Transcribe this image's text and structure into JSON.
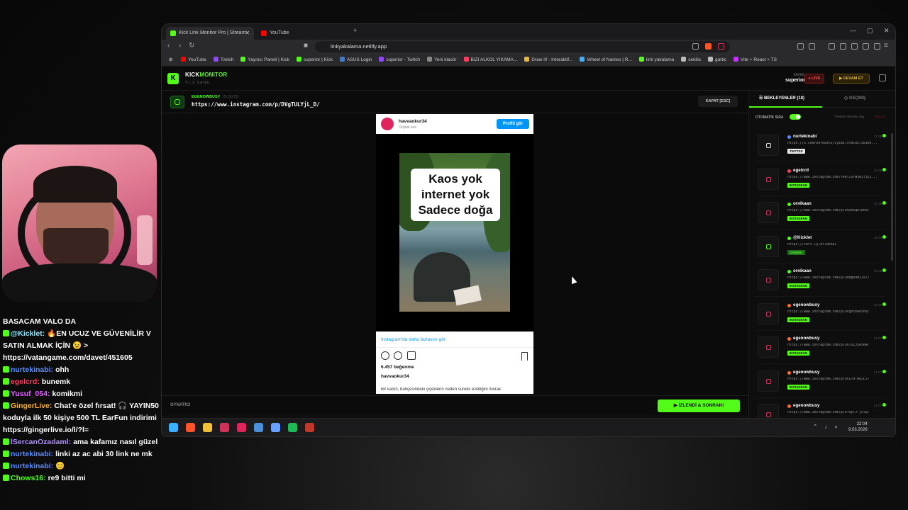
{
  "chat": [
    {
      "user": "",
      "user_color": "#ffffff",
      "text": "BASACAM VALO DA"
    },
    {
      "user": "@Kicklet:",
      "user_color": "#8be9fd",
      "text": "🔥EN UCUZ VE GÜVENİLİR V SATIN ALMAK İÇİN 😉 > https://vatangame.com/davet/451605"
    },
    {
      "user": "nurtekinabi:",
      "user_color": "#5b8cff",
      "text": "ohh"
    },
    {
      "user": "egelcrd:",
      "user_color": "#ff3b5c",
      "text": "bunemk"
    },
    {
      "user": "Yusuf_054:",
      "user_color": "#e060ff",
      "text": "komikmi"
    },
    {
      "user": "GingerLive:",
      "user_color": "#ffb020",
      "text": "Chat'e özel fırsat! 🎧 YAYIN50 koduyla ilk 50 kişiye 500 TL EarFun indirimi https://gingerlive.io/l/?l="
    },
    {
      "user": "lSercanOzadaml:",
      "user_color": "#b08cff",
      "text": "ama kafamız nasıl güzel"
    },
    {
      "user": "nurtekinabi:",
      "user_color": "#5b8cff",
      "text": "linki az ac abi 30 link ne mk"
    },
    {
      "user": "nurtekinabi:",
      "user_color": "#5b8cff",
      "text": "😊"
    },
    {
      "user": "Chows16:",
      "user_color": "#53fc18",
      "text": "re9 bitti mi"
    }
  ],
  "browser": {
    "tabs": [
      {
        "label": "Kick Link Monitor Pro | Stream",
        "active": true,
        "color": "#53fc18"
      },
      {
        "label": "YouTube",
        "active": false,
        "color": "#ff0000"
      }
    ],
    "url": "linkyakalama.netlify.app",
    "bookmarks": [
      {
        "label": "YouTube",
        "color": "#ff0000"
      },
      {
        "label": "Twitch",
        "color": "#9146ff"
      },
      {
        "label": "Yayıncı Paneli | Kick",
        "color": "#53fc18"
      },
      {
        "label": "superior | Kick",
        "color": "#53fc18"
      },
      {
        "label": "ASUS Login",
        "color": "#3a7bd5"
      },
      {
        "label": "superior - Twitch",
        "color": "#9146ff"
      },
      {
        "label": "Yeni klasör",
        "color": "#888888"
      },
      {
        "label": "BIZI ALKOL YIKAMA...",
        "color": "#ff3b5c"
      },
      {
        "label": "Draw it! - Interaktif...",
        "color": "#e8b830"
      },
      {
        "label": "Wheel of Names | R...",
        "color": "#3ab0ff"
      },
      {
        "label": "link yakalama",
        "color": "#53fc18"
      },
      {
        "label": "cekilis",
        "color": "#bbbbbb"
      },
      {
        "label": "gartic",
        "color": "#bbbbbb"
      },
      {
        "label": "Vite + React + TS",
        "color": "#bd34fe"
      }
    ]
  },
  "app": {
    "logo_letter": "K",
    "brand_a": "KICK",
    "brand_b": "MONITOR",
    "version": "V1.0 SAGE",
    "kanal_label": "KANAL",
    "kanal_name": "superior",
    "live_label": "● LIVE",
    "devam_label": "▶ DEVAM ET",
    "current": {
      "user": "EGENOWBUSY",
      "time": "21:50:23",
      "url": "https://www.instagram.com/p/DVgTULYjL_D/"
    },
    "close_label": "KAPAT [ESC]",
    "player_label": "OYNATICI",
    "next_label": "▶ İZLENDİ & SONRAKI"
  },
  "embed": {
    "user": "havvaokur34",
    "sub": "Orijinal ses",
    "profile_btn": "Profili gör",
    "overlay_lines": [
      "Kaos yok",
      "internet yok",
      "Sadece doğa"
    ],
    "more": "Instagram'da daha fazlasını gör",
    "likes": "6.457 beğenme",
    "user2": "havvaokur34",
    "caption": "Bir kadın, bahçesindeki çiçeklerin neden sürekli ezildiğini merak"
  },
  "side": {
    "tab_waiting": "BEKLEYENLER (18)",
    "tab_history": "GEÇMİŞ",
    "auto_label": "OTOMATİK SIRA",
    "auto_on": true,
    "mark_all": "Tümünü Okundu Say",
    "clear": "Temizle",
    "items": [
      {
        "user": "nurtekinabi",
        "dot": "#5b8cff",
        "time": "21:38",
        "url": "https://x.com/berbathiriyimi/status/20309...",
        "tag": "TWITTER",
        "tag_bg": "#e8e8e8",
        "tag_fg": "#111111",
        "icon": "x"
      },
      {
        "user": "egelcrd",
        "dot": "#ff3b5c",
        "time": "21:06",
        "url": "https://www.instagram.com/reel/DTWyN1fjE1...",
        "tag": "INSTAGRAM",
        "tag_bg": "#53fc18",
        "tag_fg": "#0a0a0a",
        "icon": "ig"
      },
      {
        "user": "ornikaan",
        "dot": "#53fc18",
        "time": "21:38",
        "url": "https://www.instagram.com/p/DSQ45qkiAnb/",
        "tag": "INSTAGRAM",
        "tag_bg": "#53fc18",
        "tag_fg": "#0a0a0a",
        "icon": "ig"
      },
      {
        "user": "@Kicklet",
        "dot": "#53fc18",
        "time": "21:34",
        "url": "https://cutt.ly/8tTwnnq1",
        "tag": "GENERIC",
        "tag_bg": "#1d6a20",
        "tag_fg": "#53fc18",
        "icon": "link"
      },
      {
        "user": "ornikaan",
        "dot": "#53fc18",
        "time": "21:38",
        "url": "https://www.instagram.com/p/DUBg04MjIsT/",
        "tag": "INSTAGRAM",
        "tag_bg": "#53fc18",
        "tag_fg": "#0a0a0a",
        "icon": "ig"
      },
      {
        "user": "egenowbusy",
        "dot": "#ff6a2a",
        "time": "21:37",
        "url": "https://www.instagram.com/p/DVgzteak5n8/",
        "tag": "INSTAGRAM",
        "tag_bg": "#53fc18",
        "tag_fg": "#0a0a0a",
        "icon": "ig"
      },
      {
        "user": "egenowbusy",
        "dot": "#ff6a2a",
        "time": "21:07",
        "url": "https://www.instagram.com/p/DVlsL35AS64/",
        "tag": "INSTAGRAM",
        "tag_bg": "#53fc18",
        "tag_fg": "#0a0a0a",
        "icon": "ig"
      },
      {
        "user": "egenowbusy",
        "dot": "#ff6a2a",
        "time": "21:07",
        "url": "https://www.instagram.com/p/DVLYd-mwJLT/",
        "tag": "INSTAGRAM",
        "tag_bg": "#53fc18",
        "tag_fg": "#0a0a0a",
        "icon": "ig"
      },
      {
        "user": "egenowbusy",
        "dot": "#ff6a2a",
        "time": "21:07",
        "url": "https://www.instagram.com/p/DT9yTJ-jUlQ/",
        "tag": "INSTAGRAM",
        "tag_bg": "#53fc18",
        "tag_fg": "#0a0a0a",
        "icon": "ig"
      }
    ]
  },
  "taskbar": {
    "apps": [
      {
        "name": "windows-start",
        "color": "#3ab0ff"
      },
      {
        "name": "brave",
        "color": "#fb542b"
      },
      {
        "name": "file-explorer",
        "color": "#f2c037"
      },
      {
        "name": "app-red",
        "color": "#d0335a"
      },
      {
        "name": "app-shield",
        "color": "#e0245e"
      },
      {
        "name": "steam",
        "color": "#4a90d9"
      },
      {
        "name": "app-globe",
        "color": "#6aa0ff"
      },
      {
        "name": "spotify",
        "color": "#1db954"
      },
      {
        "name": "app-obs",
        "color": "#c0392b"
      }
    ],
    "time": "22:04",
    "date": "9.03.2026"
  }
}
